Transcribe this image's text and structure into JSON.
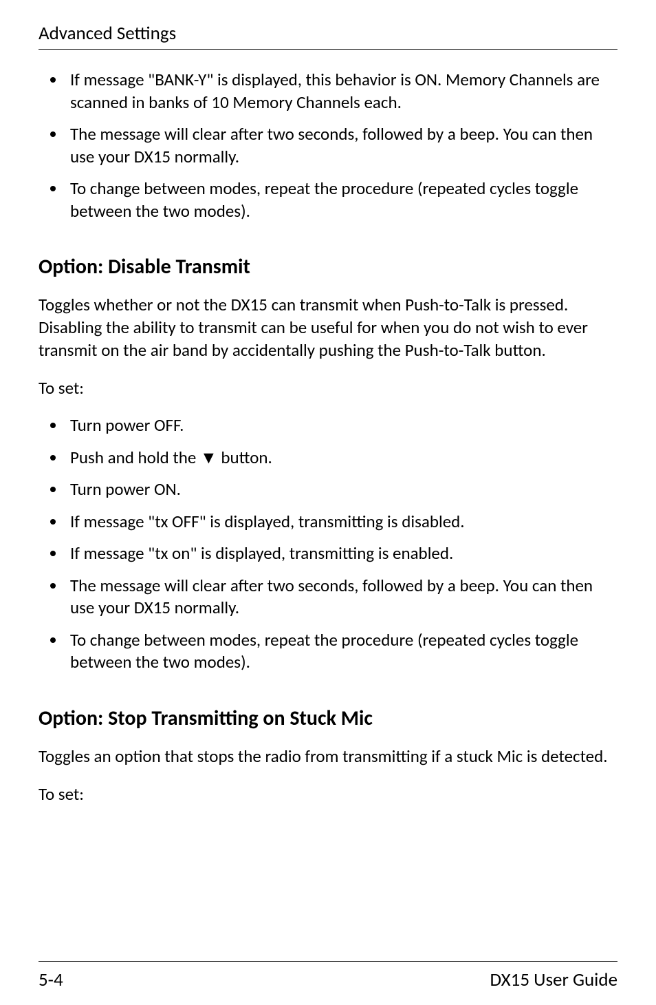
{
  "header": {
    "running": "Advanced Settings"
  },
  "top_list": {
    "items": [
      "If message \"BANK-Y\" is displayed, this behavior is ON. Memory Channels are scanned in banks of 10 Memory Channels each.",
      "The message will clear after two seconds, followed by a beep. You can then use your DX15 normally.",
      "To change between modes, repeat the procedure (repeated cycles toggle between the two modes)."
    ]
  },
  "section1": {
    "heading": "Option: Disable Transmit",
    "para": "Toggles whether or not the DX15 can transmit when Push-to-Talk is pressed. Disabling the ability to transmit can be useful for when you do not wish to ever transmit on the air band by accidentally pushing the Push-to-Talk button.",
    "toset": "To set:",
    "items": [
      "Turn power OFF.",
      "Push and hold the ▼ button.",
      "Turn power ON.",
      "If message \"tx OFF\" is displayed, transmitting is disabled.",
      "If message \"tx on\" is displayed, transmitting is enabled.",
      "The message will clear after two seconds, followed by a beep. You can then use your DX15 normally.",
      "To change between modes, repeat the procedure (repeated cycles toggle between the two modes)."
    ]
  },
  "section2": {
    "heading": "Option: Stop Transmitting on Stuck Mic",
    "para": "Toggles an option that stops the radio from transmitting if a stuck Mic is detected.",
    "toset": "To set:"
  },
  "footer": {
    "page_label": "5-4",
    "doc_title": "DX15 User Guide"
  }
}
